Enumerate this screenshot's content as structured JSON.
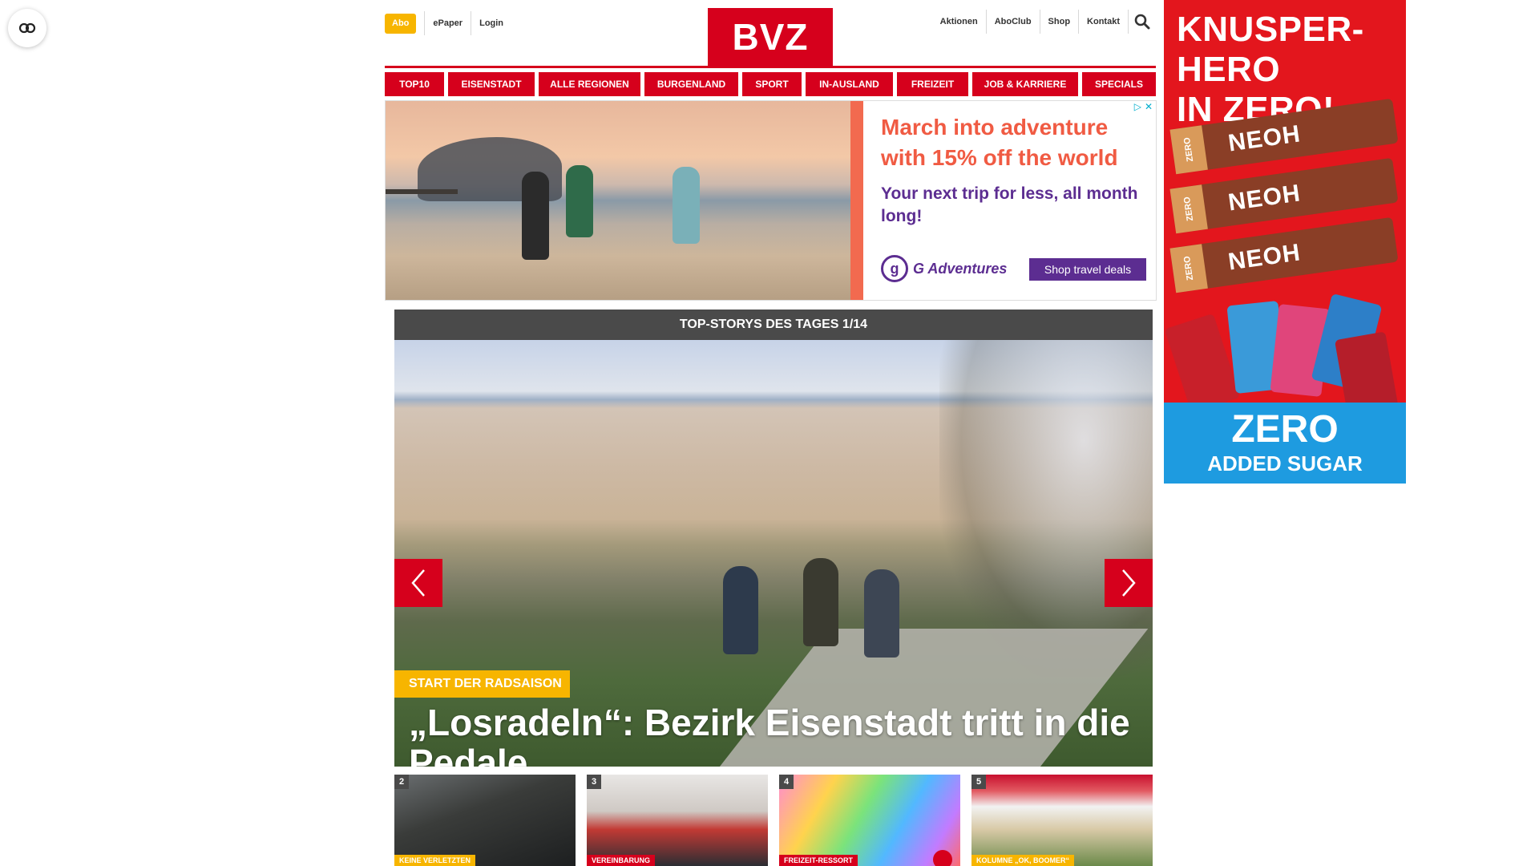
{
  "header": {
    "abo_label": "Abo",
    "top_left_links": [
      "ePaper",
      "Login"
    ],
    "logo_text": "BVZ",
    "top_right_links": [
      "Aktionen",
      "AboClub",
      "Shop",
      "Kontakt"
    ]
  },
  "nav": {
    "items": [
      "TOP10",
      "EISENSTADT",
      "ALLE REGIONEN",
      "BURGENLAND",
      "SPORT",
      "IN-AUSLAND",
      "FREIZEIT",
      "JOB & KARRIERE",
      "SPECIALS"
    ]
  },
  "ad_banner": {
    "headline": "March into adventure with 15% off the world",
    "subline": "Your next trip for less, all month long!",
    "brand": "G Adventures",
    "cta": "Shop travel deals"
  },
  "top_stories": {
    "header": "TOP-STORYS DES TAGES 1/14",
    "hero_tag": "START DER RADSAISON",
    "hero_title": "„Losradeln“: Bezirk Eisenstadt tritt in die Pedale",
    "thumbs": [
      {
        "num": "2",
        "tag": "KEINE VERLETZTEN"
      },
      {
        "num": "3",
        "tag": "VEREINBARUNG"
      },
      {
        "num": "4",
        "tag": "FREIZEIT-RESSORT"
      },
      {
        "num": "5",
        "tag": "KOLUMNE „OK, BOOMER“"
      }
    ]
  },
  "sky_ad": {
    "title_line1": "KNUSPER-HERO",
    "title_line2": "IN ZERO!",
    "bar_brand": "NEOH",
    "bar_zero": "ZERO",
    "bottom_line1": "ZERO",
    "bottom_line2": "ADDED SUGAR"
  },
  "colors": {
    "brand_red": "#d6001c",
    "abo_yellow": "#f7b500",
    "story_header": "#4a4a4a"
  }
}
